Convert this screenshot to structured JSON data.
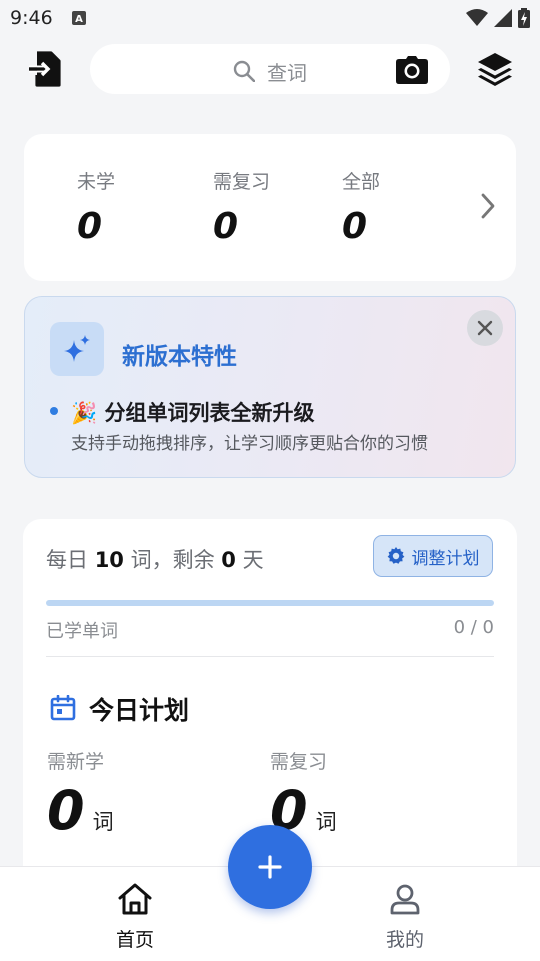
{
  "status_bar": {
    "time": "9:46"
  },
  "search": {
    "placeholder": "查词"
  },
  "stats": {
    "items": [
      {
        "label": "未学",
        "value": "0"
      },
      {
        "label": "需复习",
        "value": "0"
      },
      {
        "label": "全部",
        "value": "0"
      }
    ]
  },
  "feature": {
    "title": "新版本特性",
    "item_title": "🎉 分组单词列表全新升级",
    "item_desc": "支持手动拖拽排序，让学习顺序更贴合你的习惯"
  },
  "plan": {
    "daily_prefix": "每日 ",
    "daily_count": "10",
    "daily_mid": " 词，剩余 ",
    "days_left": "0",
    "daily_suffix": " 天",
    "adjust_label": "调整计划",
    "learned_label": "已学单词",
    "learned_value": "0 / 0",
    "progress_fraction": 0,
    "today_title": "今日计划",
    "new_label": "需新学",
    "new_value": "0",
    "review_label": "需复习",
    "review_value": "0",
    "unit": "词"
  },
  "nav": {
    "home": "首页",
    "mine": "我的"
  },
  "colors": {
    "accent": "#2f6fe0",
    "feature_title": "#2c6fd1",
    "progress_track": "#bcd6f3"
  }
}
